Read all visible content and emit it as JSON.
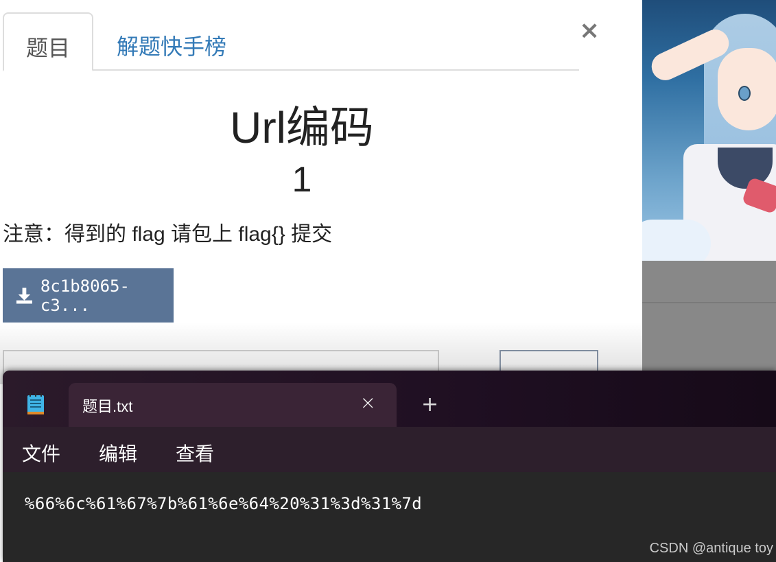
{
  "modal": {
    "tabs": [
      {
        "label": "题目",
        "active": true
      },
      {
        "label": "解题快手榜",
        "active": false
      }
    ],
    "close_label": "×",
    "challenge_title": "Url编码",
    "points": "1",
    "note": "注意：得到的 flag 请包上 flag{} 提交",
    "download_label": "8c1b8065-c3..."
  },
  "notepad": {
    "tab_title": "题目.txt",
    "close_label": "×",
    "new_tab_label": "+",
    "menu": [
      "文件",
      "编辑",
      "查看"
    ],
    "content": "%66%6c%61%67%7b%61%6e%64%20%31%3d%31%7d"
  },
  "watermark": "CSDN @antique toy",
  "colors": {
    "download_button": "#5a7496",
    "tab_link": "#337ab7",
    "notepad_bg": "#272727"
  },
  "icons": {
    "download": "download-icon",
    "notepad_app": "notepad-icon"
  }
}
